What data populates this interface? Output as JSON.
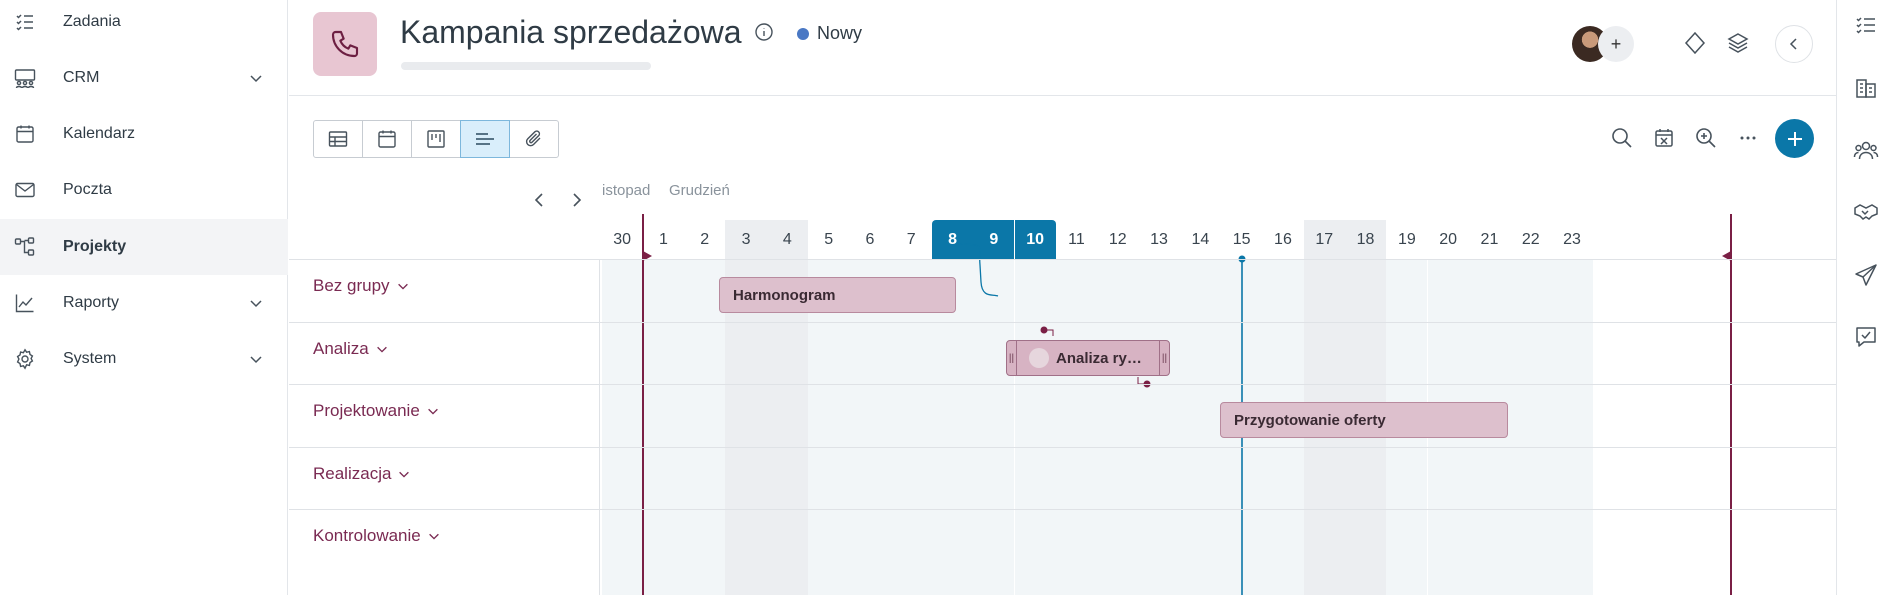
{
  "sidebar": {
    "items": [
      {
        "label": "Zadania",
        "icon": "tasks-list-icon",
        "expandable": false,
        "active": false
      },
      {
        "label": "CRM",
        "icon": "people-group-icon",
        "expandable": true,
        "active": false
      },
      {
        "label": "Kalendarz",
        "icon": "calendar-icon",
        "expandable": false,
        "active": false
      },
      {
        "label": "Poczta",
        "icon": "mail-icon",
        "expandable": false,
        "active": false
      },
      {
        "label": "Projekty",
        "icon": "projects-tree-icon",
        "expandable": false,
        "active": true
      },
      {
        "label": "Raporty",
        "icon": "chart-line-icon",
        "expandable": true,
        "active": false
      },
      {
        "label": "System",
        "icon": "gear-icon",
        "expandable": true,
        "active": false
      }
    ]
  },
  "header": {
    "title": "Kampania sprzedażowa",
    "status": "Nowy",
    "status_color": "#4a78c4",
    "avatar_add": "+"
  },
  "views": [
    "table-view-icon",
    "calendar-view-icon",
    "kanban-view-icon",
    "gantt-view-icon",
    "attachments-view-icon"
  ],
  "active_view": "gantt-view-icon",
  "gantt": {
    "months": [
      "istopad",
      "Grudzień"
    ],
    "days": [
      "30",
      "1",
      "2",
      "3",
      "4",
      "5",
      "6",
      "7",
      "8",
      "9",
      "10",
      "11",
      "12",
      "13",
      "14",
      "15",
      "16",
      "17",
      "18",
      "19",
      "20",
      "21",
      "22",
      "23"
    ],
    "selected_days": [
      "8",
      "9",
      "10"
    ],
    "lanes": [
      "Bez grupy",
      "Analiza",
      "Projektowanie",
      "Realizacja",
      "Kontrolowanie"
    ],
    "tasks": [
      {
        "name": "Harmonogram",
        "lane": "Bez grupy"
      },
      {
        "name": "Analiza ry…",
        "lane": "Analiza"
      },
      {
        "name": "Przygotowanie oferty",
        "lane": "Projektowanie"
      }
    ]
  },
  "colors": {
    "accent": "#0b77a8",
    "task_fill": "#ddc0cd",
    "lane_label": "#7a2a52",
    "marker": "#7a1f45"
  }
}
